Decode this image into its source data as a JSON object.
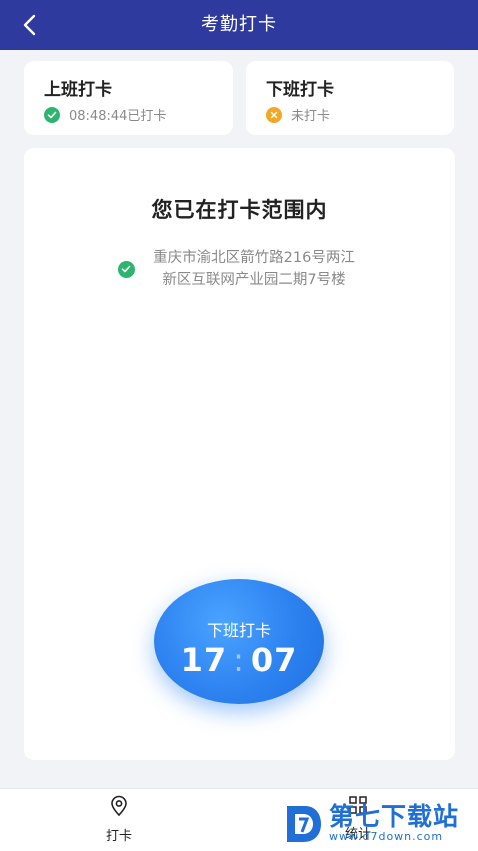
{
  "header": {
    "title": "考勤打卡",
    "back_icon": "chevron-left-icon"
  },
  "clock_in": {
    "title": "上班打卡",
    "status": "08:48:44已打卡",
    "status_color": "#2db56f"
  },
  "clock_out": {
    "title": "下班打卡",
    "status": "未打卡",
    "status_color": "#f5a623"
  },
  "range": {
    "title": "您已在打卡范围内",
    "address": "重庆市渝北区箭竹路216号两江新区互联网产业园二期7号楼"
  },
  "punch_button": {
    "label": "下班打卡",
    "hour": "17",
    "minute": "07",
    "color": "#2d82f0"
  },
  "tabs": [
    {
      "label": "打卡",
      "icon": "location-pin-icon"
    },
    {
      "label": "统计",
      "icon": "grid-icon"
    }
  ],
  "watermark": {
    "main": "第七下载站",
    "sub": "www.d7down.com"
  }
}
